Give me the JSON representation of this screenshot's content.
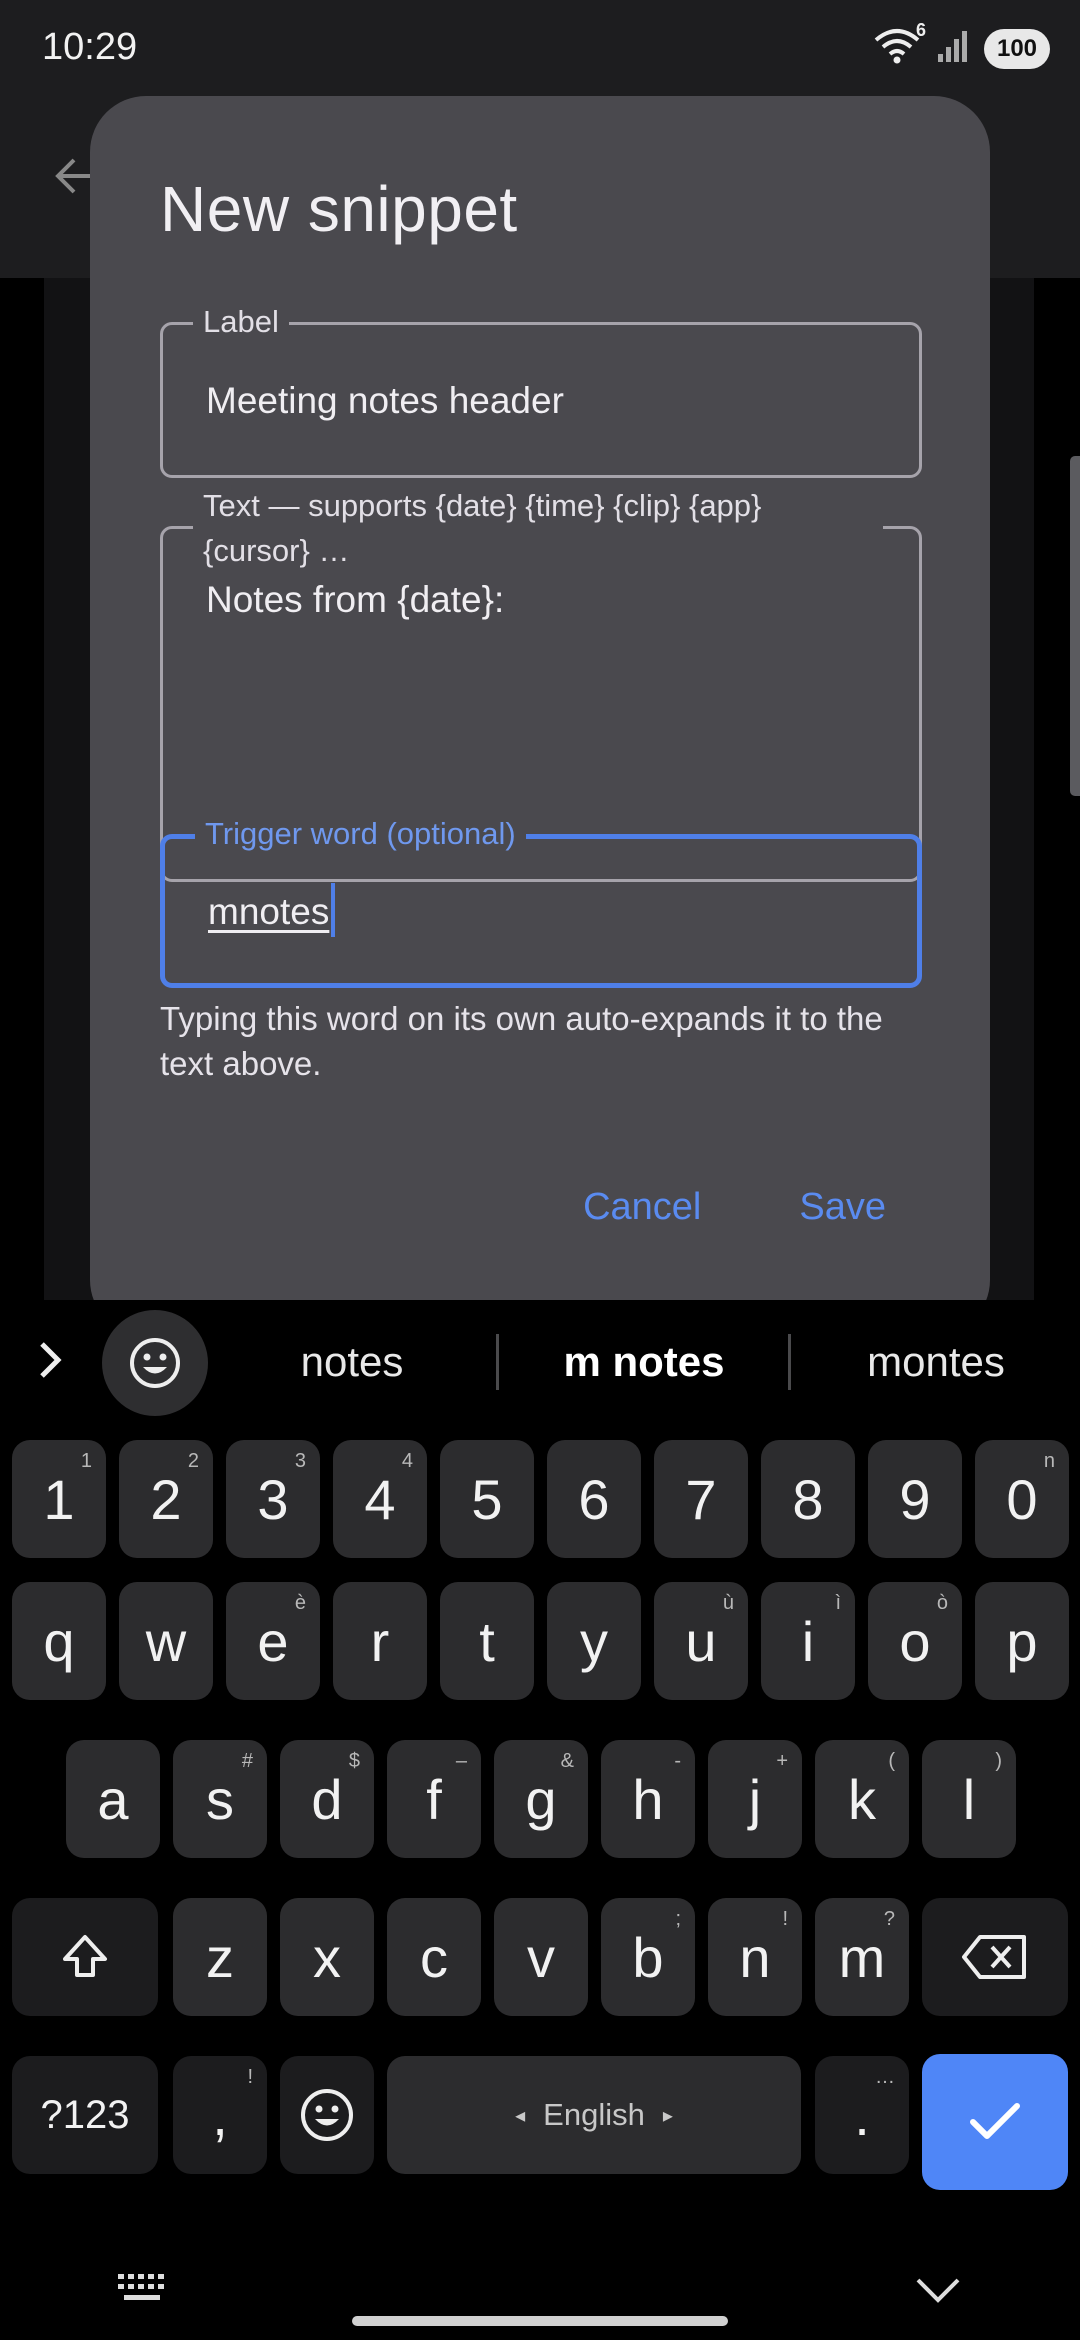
{
  "status_bar": {
    "time": "10:29",
    "wifi_badge": "6",
    "battery": "100"
  },
  "dialog": {
    "title": "New snippet",
    "label_field": {
      "label": "Label",
      "value": "Meeting notes header"
    },
    "text_field": {
      "label": "Text — supports {date} {time} {clip} {app} {cursor} …",
      "value": "Notes from {date}:"
    },
    "trigger_field": {
      "label": "Trigger word (optional)",
      "value": "mnotes"
    },
    "helper_text": "Typing this word on its own auto-expands it to the text above.",
    "cancel_label": "Cancel",
    "save_label": "Save"
  },
  "keyboard": {
    "suggestions": [
      "notes",
      "m notes",
      "montes"
    ],
    "number_row": [
      {
        "key": "1",
        "hint": "1"
      },
      {
        "key": "2",
        "hint": "2"
      },
      {
        "key": "3",
        "hint": "3"
      },
      {
        "key": "4",
        "hint": "4"
      },
      {
        "key": "5",
        "hint": ""
      },
      {
        "key": "6",
        "hint": ""
      },
      {
        "key": "7",
        "hint": ""
      },
      {
        "key": "8",
        "hint": ""
      },
      {
        "key": "9",
        "hint": ""
      },
      {
        "key": "0",
        "hint": "n"
      }
    ],
    "row1": [
      {
        "key": "q",
        "hint": ""
      },
      {
        "key": "w",
        "hint": ""
      },
      {
        "key": "e",
        "hint": "è"
      },
      {
        "key": "r",
        "hint": ""
      },
      {
        "key": "t",
        "hint": ""
      },
      {
        "key": "y",
        "hint": ""
      },
      {
        "key": "u",
        "hint": "ù"
      },
      {
        "key": "i",
        "hint": "ì"
      },
      {
        "key": "o",
        "hint": "ò"
      },
      {
        "key": "p",
        "hint": ""
      }
    ],
    "row2": [
      {
        "key": "a",
        "hint": ""
      },
      {
        "key": "s",
        "hint": "#"
      },
      {
        "key": "d",
        "hint": "$"
      },
      {
        "key": "f",
        "hint": "–"
      },
      {
        "key": "g",
        "hint": "&"
      },
      {
        "key": "h",
        "hint": "-"
      },
      {
        "key": "j",
        "hint": "+"
      },
      {
        "key": "k",
        "hint": "("
      },
      {
        "key": "l",
        "hint": ")"
      }
    ],
    "row3": [
      {
        "key": "z",
        "hint": ""
      },
      {
        "key": "x",
        "hint": ""
      },
      {
        "key": "c",
        "hint": ""
      },
      {
        "key": "v",
        "hint": ""
      },
      {
        "key": "b",
        "hint": ";"
      },
      {
        "key": "n",
        "hint": "!"
      },
      {
        "key": "m",
        "hint": "?"
      }
    ],
    "symbols_label": "?123",
    "comma": {
      "key": ",",
      "hint": "!"
    },
    "period": {
      "key": ".",
      "hint": "…"
    },
    "space_label": "English"
  },
  "colors": {
    "accent": "#4f86f7",
    "dialog_bg": "#4a494e",
    "focus_border": "#4f7fe8"
  }
}
